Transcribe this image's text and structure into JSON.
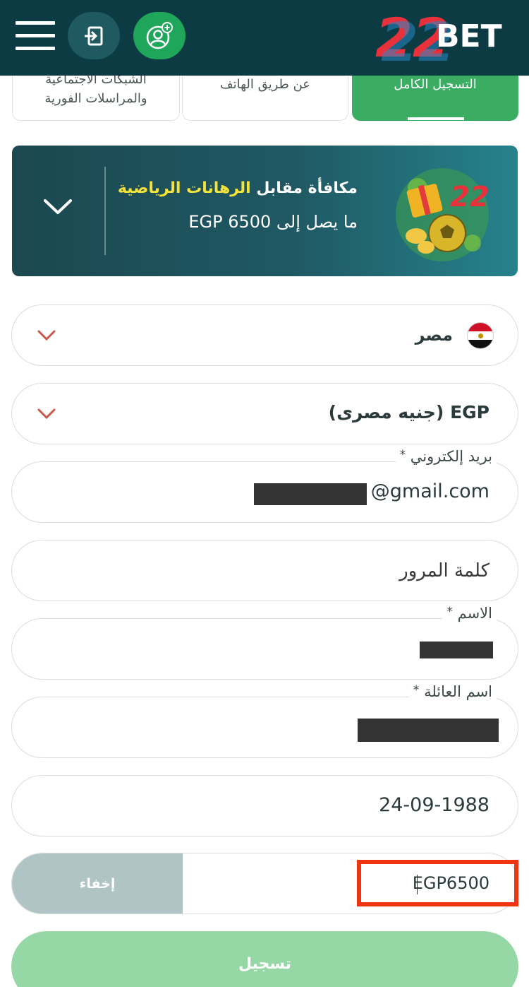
{
  "header": {
    "menu_icon": "hamburger-menu-icon",
    "login_icon": "login-icon",
    "register_icon": "register-user-icon",
    "logo_digits": "22",
    "logo_text": "BET"
  },
  "tabs": [
    {
      "label_line1": "الشبكات الاجتماعية",
      "label_line2": "والمراسلات الفورية"
    },
    {
      "label": "عن طريق الهاتف"
    },
    {
      "label": "التسجيل الكامل",
      "active": true
    }
  ],
  "bonus": {
    "title_prefix": "مكافأة مقابل ",
    "title_highlight": "الرهانات الرياضية",
    "subtitle": "ما يصل إلى EGP 6500",
    "accent_color": "#f5e23a"
  },
  "form": {
    "country": {
      "value": "مصر",
      "flag_icon": "egypt-flag-icon"
    },
    "currency": {
      "value": "EGP (جنيه مصرى)"
    },
    "email": {
      "label": "بريد إلكتروني",
      "required_mark": "*",
      "value": "@gmail.com"
    },
    "password": {
      "placeholder": "كلمة المرور"
    },
    "first_name": {
      "label": "الاسم",
      "required_mark": "*"
    },
    "last_name": {
      "label": "اسم العائلة",
      "required_mark": "*"
    },
    "birth_date": {
      "value": "24-09-1988"
    },
    "promo": {
      "value": "EGP6500",
      "hide_label": "إخفاء"
    },
    "submit_label": "تسجيل"
  },
  "colors": {
    "header_bg": "#0d3b44",
    "active_tab": "#3aad62",
    "submit_bg": "#95d8a6",
    "highlight_border": "#f03412"
  }
}
